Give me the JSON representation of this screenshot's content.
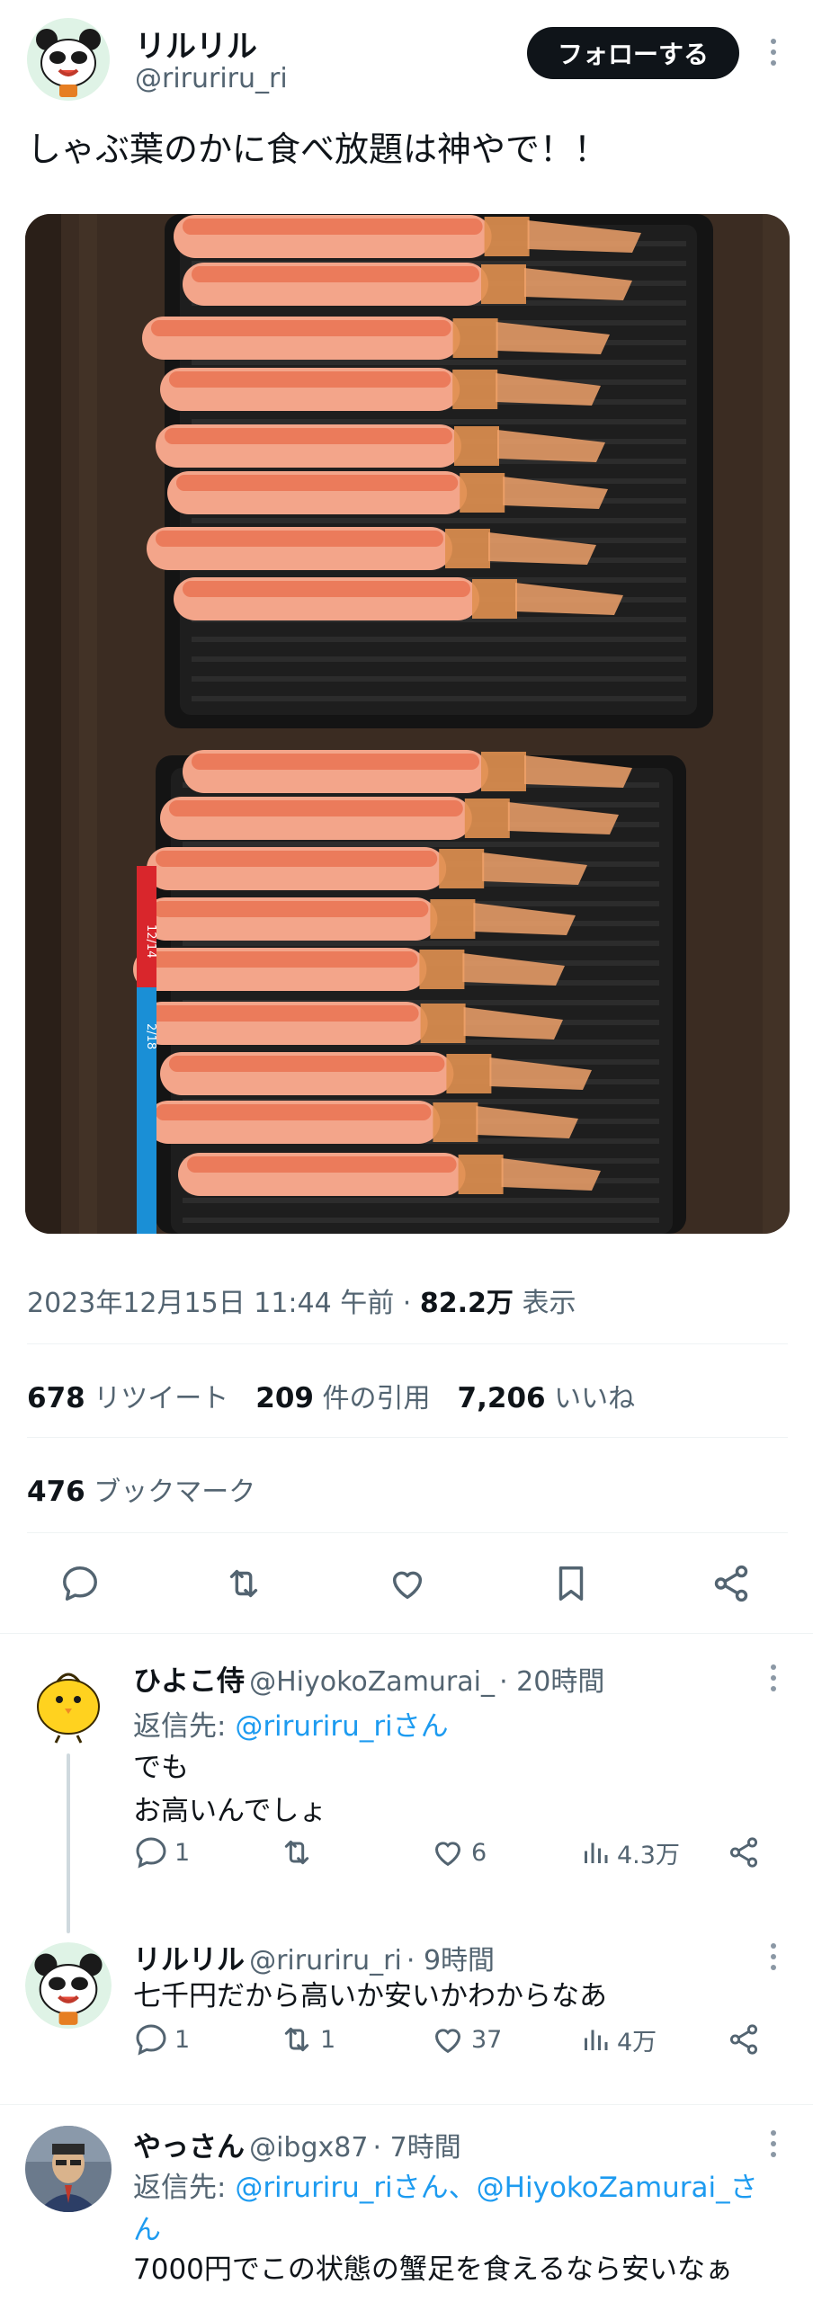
{
  "tweet": {
    "display_name": "リルリル",
    "handle": "@riruriru_ri",
    "follow_label": "フォローする",
    "text": "しゃぶ葉のかに食べ放題は神やで！！",
    "timestamp": "2023年12月15日 11:44 午前",
    "separator": "·",
    "views_count": "82.2万",
    "views_label": "表示",
    "retweets_count": "678",
    "retweets_label": "リツイート",
    "quotes_count": "209",
    "quotes_label": "件の引用",
    "likes_count": "7,206",
    "likes_label": "いいね",
    "bookmarks_count": "476",
    "bookmarks_label": "ブックマーク",
    "photo_text": {
      "price_sticker_1": "12/14",
      "price_sticker_2": "2/18"
    }
  },
  "replies": [
    {
      "display_name": "ひよこ侍",
      "handle": "@HiyokoZamurai_",
      "time": "· 20時間",
      "replying_label": "返信先:",
      "replying_to": "@riruriru_riさん",
      "text_line1": "でも",
      "text_line2": "お高いんでしょ",
      "reply_count": "1",
      "retweet_count": "",
      "like_count": "6",
      "view_count": "4.3万"
    },
    {
      "display_name": "リルリル",
      "handle": "@riruriru_ri",
      "time": "· 9時間",
      "text_line1": "七千円だから高いか安いかわからなあ",
      "reply_count": "1",
      "retweet_count": "1",
      "like_count": "37",
      "view_count": "4万"
    },
    {
      "display_name": "やっさん",
      "handle": "@ibgx87",
      "time": "· 7時間",
      "replying_label": "返信先:",
      "replying_to": "@riruriru_riさん、@HiyokoZamurai_さん",
      "text_line1": "7000円でこの状態の蟹足を食えるなら安いなぁ"
    }
  ],
  "colors": {
    "accent": "#1d9bf0",
    "text_primary": "#0f1419",
    "text_secondary": "#536471"
  }
}
